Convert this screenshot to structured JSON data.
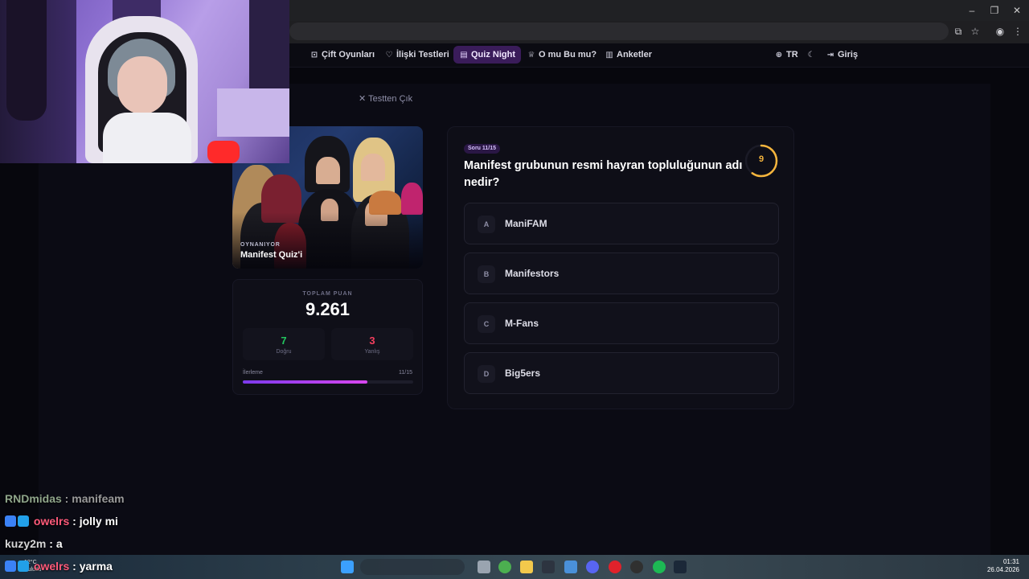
{
  "nav": {
    "items": [
      {
        "icon": "gamepad-icon",
        "label": "Çift Oyunları",
        "active": false
      },
      {
        "icon": "heart-icon",
        "label": "İlişki Testleri",
        "active": false
      },
      {
        "icon": "quiz-icon",
        "label": "Quiz Night",
        "active": true
      },
      {
        "icon": "trophy-icon",
        "label": "O mu Bu mu?",
        "active": false
      },
      {
        "icon": "chart-icon",
        "label": "Anketler",
        "active": false
      }
    ],
    "language": "TR",
    "login": "Giriş"
  },
  "exit_label": "Testten Çık",
  "sidebar": {
    "playing_label": "OYNANIYOR",
    "quiz_name": "Manifest Quiz'i",
    "score_label": "TOPLAM PUAN",
    "score_value": "9.261",
    "correct_count": "7",
    "correct_label": "Doğru",
    "wrong_count": "3",
    "wrong_label": "Yanlış",
    "progress_label": "İlerleme",
    "progress_count": "11/15",
    "progress_fraction": 0.733
  },
  "question": {
    "badge": "Soru 11/15",
    "text": "Manifest grubunun resmi hayran topluluğunun adı nedir?",
    "timer": "9",
    "timer_fraction": 0.6,
    "options": [
      {
        "letter": "A",
        "text": "ManiFAM"
      },
      {
        "letter": "B",
        "text": "Manifestors"
      },
      {
        "letter": "C",
        "text": "M-Fans"
      },
      {
        "letter": "D",
        "text": "Big5ers"
      }
    ]
  },
  "chat": [
    {
      "user": "RNDmidas",
      "message": "manifeam",
      "style": "dim"
    },
    {
      "user": "owelrs",
      "message": "jolly mi",
      "style": "badge"
    },
    {
      "user": "kuzy2m",
      "message": "a",
      "style": "plain"
    },
    {
      "user": "owelrs",
      "message": "yarma",
      "style": "badge"
    }
  ],
  "taskbar": {
    "weather_temp": "12°C",
    "weather_desc": "Bulutlu",
    "time": "01:31",
    "date": "26.04.2026"
  },
  "colors": {
    "accent": "#7c3aed",
    "accent_end": "#d946ef",
    "correct": "#22c55e",
    "wrong": "#f43f5e",
    "timer": "#f5b53d"
  }
}
